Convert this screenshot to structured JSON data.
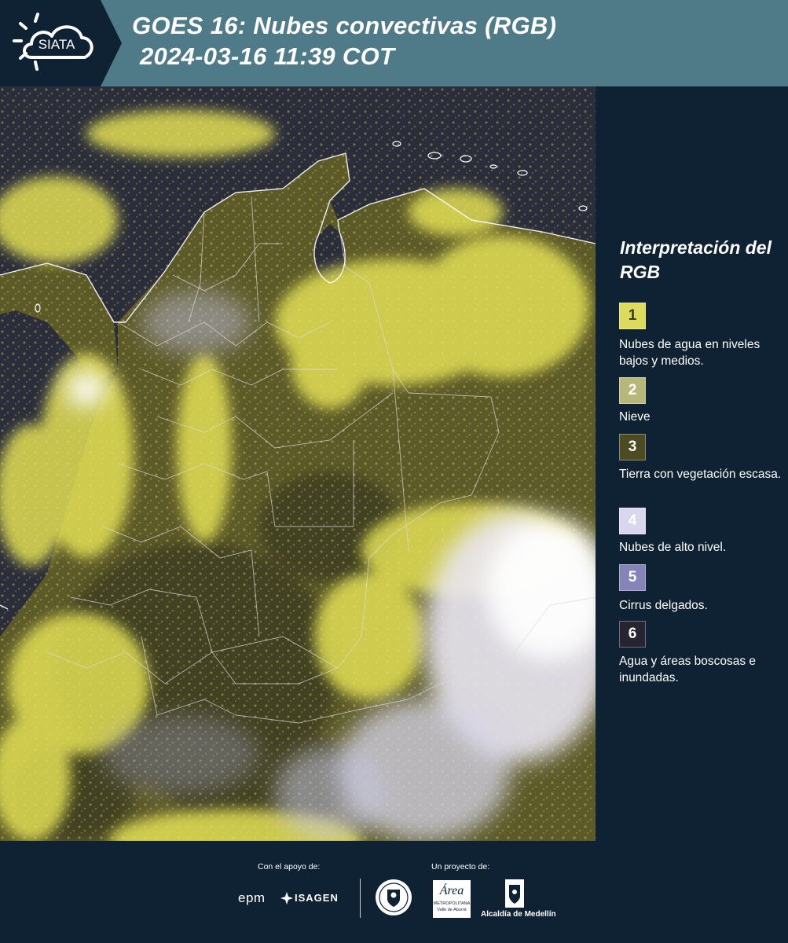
{
  "header": {
    "logo_text": "SIATA",
    "title_line_1": "GOES 16: Nubes convectivas (RGB)",
    "title_line_2": "2024-03-16 11:39 COT",
    "background_color": "#4f7a88"
  },
  "map": {
    "description_icon": "satellite-rgb-map",
    "land_cloud_color": "#e6e35a",
    "high_cloud_color": "#f2eef6",
    "ocean_color": "#2a2c3a"
  },
  "legend": {
    "title": "Interpretación del RGB",
    "items": [
      {
        "number": "1",
        "label": "Nubes de agua en niveles bajos y medios.",
        "color": "#dcdb5b",
        "text_color": "#3a3a1a"
      },
      {
        "number": "2",
        "label": "Nieve",
        "color": "#b7b77a",
        "text_color": "#ffffff"
      },
      {
        "number": "3",
        "label": "Tierra con vegetación escasa.",
        "color": "#4d4b22",
        "text_color": "#ffffff"
      },
      {
        "number": "4",
        "label": "Nubes de alto nivel.",
        "color": "#d9d7ee",
        "text_color": "#ffffff"
      },
      {
        "number": "5",
        "label": "Cirrus delgados.",
        "color": "#8584b9",
        "text_color": "#ffffff"
      },
      {
        "number": "6",
        "label": "Agua y áreas boscosas e inundadas.",
        "color": "#262431",
        "text_color": "#ffffff"
      }
    ]
  },
  "footer": {
    "support_caption": "Con el apoyo de:",
    "project_caption": "Un proyecto de:",
    "epm_logo": "epm",
    "isagen_logo": "ISAGEN",
    "area_logo": "Área",
    "area_sub_1": "METROPOLITANA",
    "area_sub_2": "Valle de Aburrá",
    "alcaldia_logo": "Alcaldía de Medellín"
  }
}
